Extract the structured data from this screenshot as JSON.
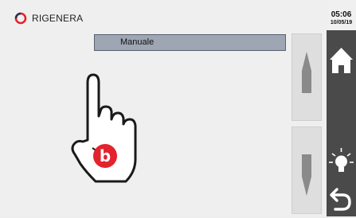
{
  "app": {
    "name": "RIGENERA",
    "logo_icon": "rigenera-logo-icon"
  },
  "status": {
    "time": "05:06",
    "date": "10/05/19"
  },
  "mode": {
    "label": "Manuale"
  },
  "scroll": {
    "up_icon": "arrow-up-icon",
    "down_icon": "arrow-down-icon"
  },
  "sidebar": {
    "home_icon": "home-icon",
    "light_icon": "lightbulb-icon",
    "back_icon": "back-arrow-icon"
  },
  "hand": {
    "icon": "hand-pointer-icon",
    "badge_letter": "b"
  },
  "colors": {
    "accent": "#e3232d",
    "sidebar_bg": "#4a4a4a",
    "select_bg": "#9fa6b3"
  }
}
